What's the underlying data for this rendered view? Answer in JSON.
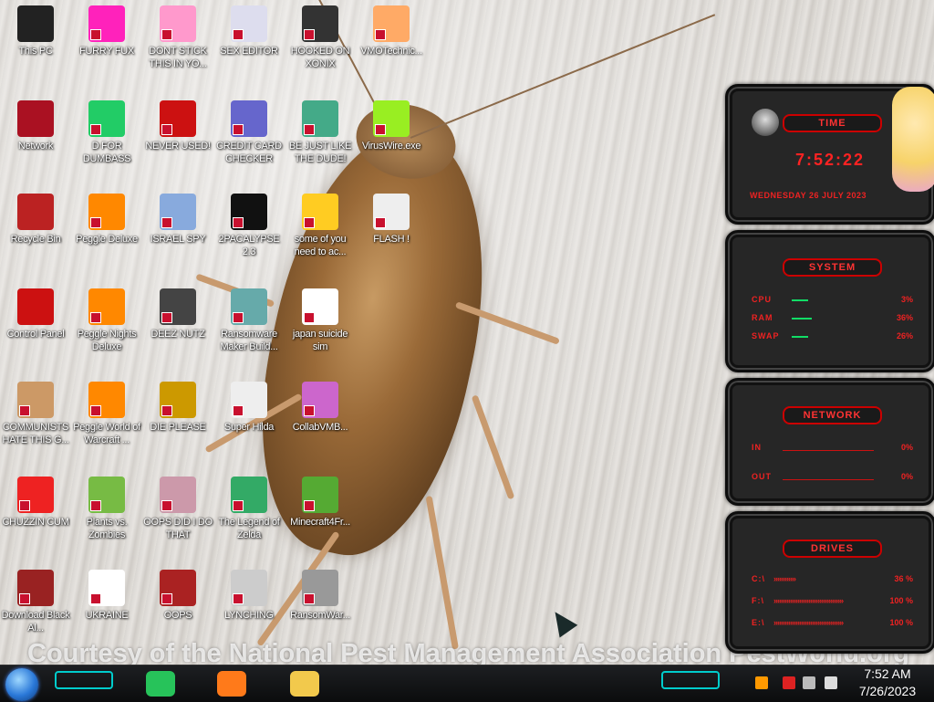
{
  "desktop": {
    "watermark": "Courtesy of the National Pest Management Association PestWorld.org",
    "icons": [
      {
        "label": "This PC"
      },
      {
        "label": "FURRY FUX"
      },
      {
        "label": "DONT STICK THIS IN YO..."
      },
      {
        "label": "SEX EDITOR"
      },
      {
        "label": "HOOKED ON XONIX"
      },
      {
        "label": "VMOTechnic..."
      },
      {
        "label": "Network"
      },
      {
        "label": "D FOR DUMBASS"
      },
      {
        "label": "NEVER USED!"
      },
      {
        "label": "CREDIT CARD CHECKER"
      },
      {
        "label": "BE JUST LIKE THE DUDE!"
      },
      {
        "label": "VirusWire.exe"
      },
      {
        "label": "Recycle Bin"
      },
      {
        "label": "Peggle Deluxe"
      },
      {
        "label": "ISRAEL SPY"
      },
      {
        "label": "2PACALYPSE 2.3"
      },
      {
        "label": "some of you need to ac..."
      },
      {
        "label": "FLASH !"
      },
      {
        "label": "Control Panel"
      },
      {
        "label": "Peggle Nights Deluxe"
      },
      {
        "label": "DEEZ NUTZ"
      },
      {
        "label": "Ransomware Maker Build..."
      },
      {
        "label": "japan suicide sim"
      },
      {
        "label": "COMMUNISTS HATE THIS G..."
      },
      {
        "label": "Peggle World of Warcraft ..."
      },
      {
        "label": "DIE PLEASE"
      },
      {
        "label": "Super Hilda"
      },
      {
        "label": "CollabVMB..."
      },
      {
        "label": "CHUZZIN CUM"
      },
      {
        "label": "Plants vs. Zombies"
      },
      {
        "label": "OOPS DID I DO THAT"
      },
      {
        "label": "The Legend of Zelda"
      },
      {
        "label": "Minecraft4Fr..."
      },
      {
        "label": "Download Black Al..."
      },
      {
        "label": "UKRAINE"
      },
      {
        "label": "OOPS"
      },
      {
        "label": "LYNCHING"
      },
      {
        "label": "RansomWar..."
      }
    ]
  },
  "widgets": {
    "time": {
      "title": "TIME",
      "clock": "7:52:22",
      "date": "WEDNESDAY 26 JULY 2023"
    },
    "system": {
      "title": "SYSTEM",
      "rows": [
        {
          "label": "CPU",
          "value": "3%",
          "level": 0.03
        },
        {
          "label": "RAM",
          "value": "36%",
          "level": 0.36
        },
        {
          "label": "SWAP",
          "value": "26%",
          "level": 0.26
        }
      ]
    },
    "network": {
      "title": "NETWORK",
      "rows": [
        {
          "label": "IN",
          "value": "0%"
        },
        {
          "label": "OUT",
          "value": "0%"
        }
      ]
    },
    "drives": {
      "title": "DRIVES",
      "rows": [
        {
          "label": "C:\\",
          "value": "36 %",
          "chevrons": "»»»»»»",
          "level": 0.36
        },
        {
          "label": "F:\\",
          "value": "100 %",
          "chevrons": "»»»»»»»»»»»»»»»»»»»",
          "level": 1.0
        },
        {
          "label": "E:\\",
          "value": "100 %",
          "chevrons": "»»»»»»»»»»»»»»»»»»»",
          "level": 1.0
        }
      ]
    }
  },
  "taskbar": {
    "start_icon": "start-orb-icon",
    "pinned": [
      {
        "name": "notes-app-icon",
        "color": "#27c35a"
      },
      {
        "name": "firefox-icon",
        "color": "#ff7a1a"
      },
      {
        "name": "file-explorer-icon",
        "color": "#f2c94c"
      }
    ],
    "clock_time": "7:52 AM",
    "clock_date": "7/26/2023",
    "tray_icons": [
      "flag-icon",
      "security-flag-icon",
      "network-icon",
      "volume-icon"
    ]
  }
}
